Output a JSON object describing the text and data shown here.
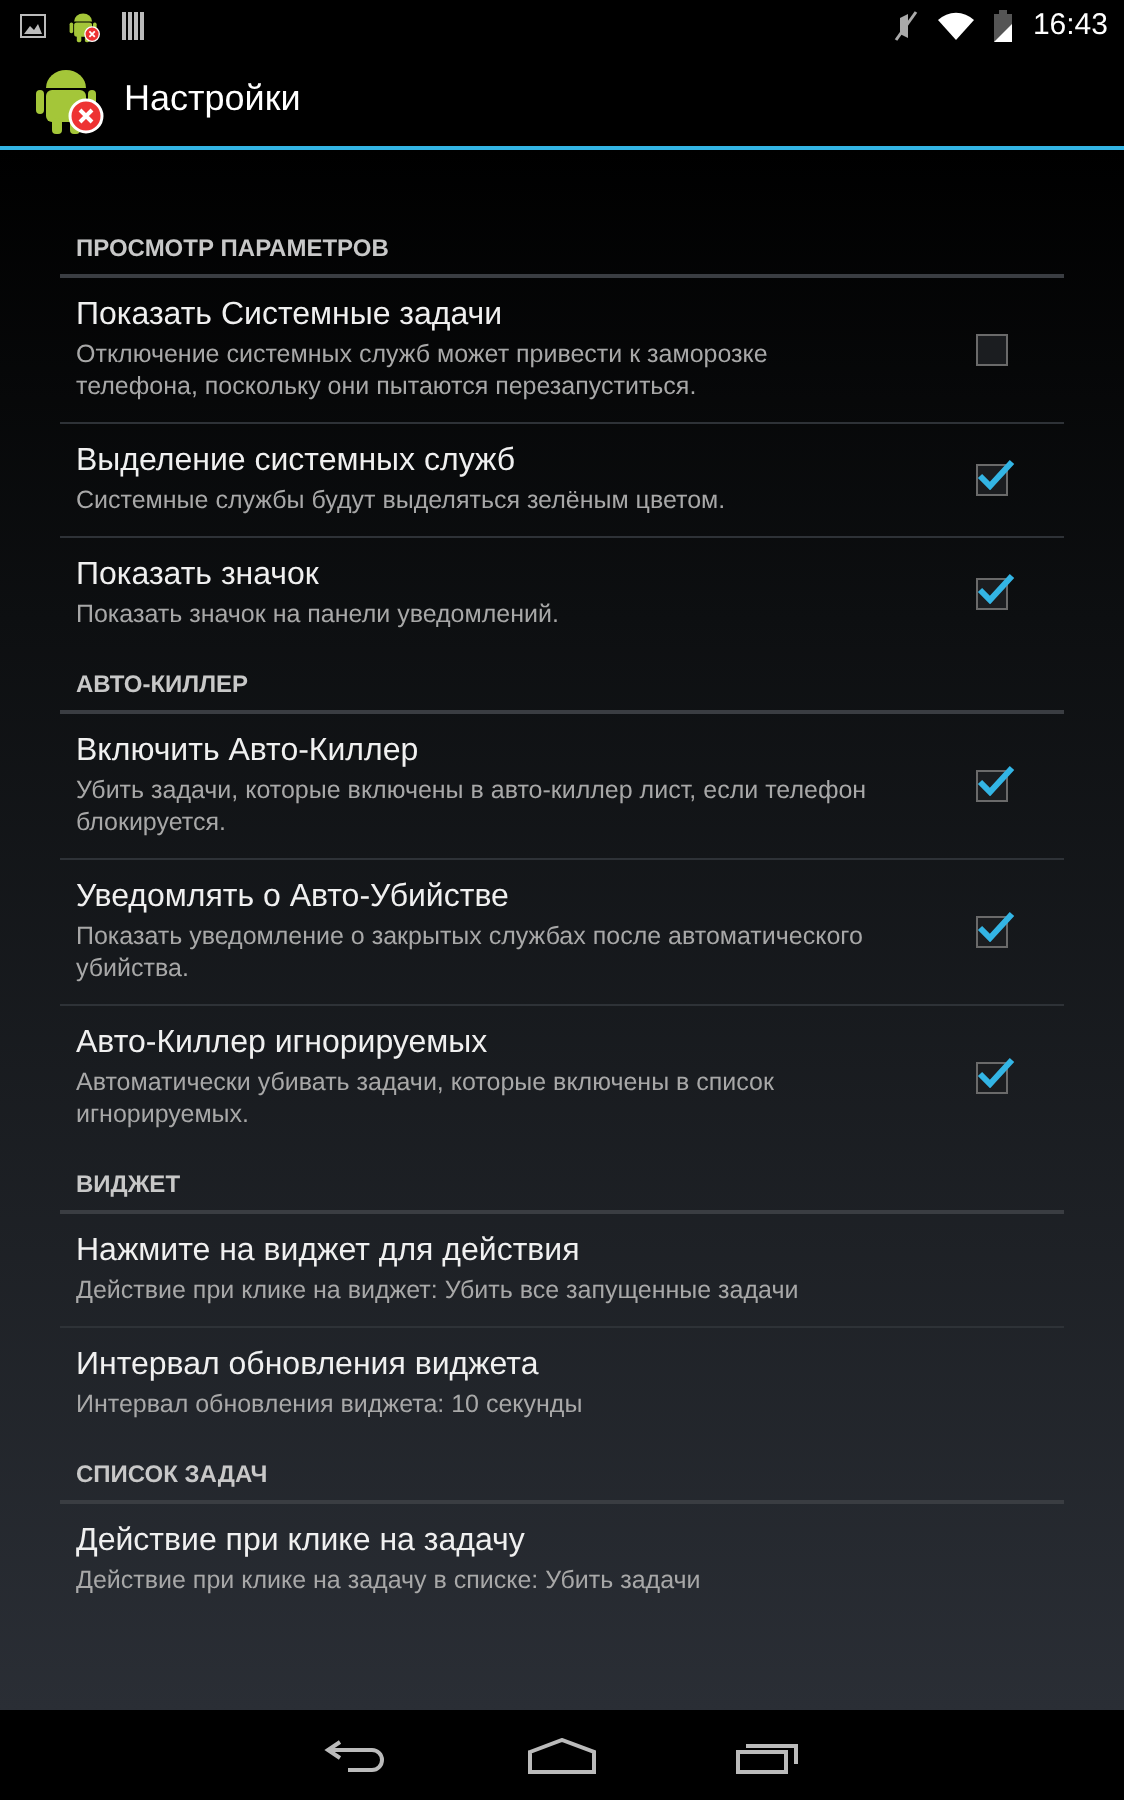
{
  "status_bar": {
    "time": "16:43"
  },
  "action_bar": {
    "title": "Настройки"
  },
  "sections": [
    {
      "header": "ПРОСМОТР ПАРАМЕТРОВ",
      "items": [
        {
          "kind": "checkbox",
          "title": "Показать Системные задачи",
          "summary": "Отключение системных служб может привести к заморозке телефона, поскольку они пытаются перезапуститься.",
          "checked": false
        },
        {
          "kind": "checkbox",
          "title": "Выделение системных служб",
          "summary": "Системные службы будут выделяться зелёным цветом.",
          "checked": true
        },
        {
          "kind": "checkbox",
          "title": "Показать значок",
          "summary": "Показать значок на панели уведомлений.",
          "checked": true
        }
      ]
    },
    {
      "header": "АВТО-КИЛЛЕР",
      "items": [
        {
          "kind": "checkbox",
          "title": "Включить Авто-Киллер",
          "summary": "Убить задачи, которые включены в авто-киллер лист, если телефон блокируется.",
          "checked": true
        },
        {
          "kind": "checkbox",
          "title": "Уведомлять о Авто-Убийстве",
          "summary": "Показать уведомление о закрытых службах после автоматического убийства.",
          "checked": true
        },
        {
          "kind": "checkbox",
          "title": "Авто-Киллер игнорируемых",
          "summary": "Автоматически убивать задачи, которые включены в список игнорируемых.",
          "checked": true
        }
      ]
    },
    {
      "header": "ВИДЖЕТ",
      "items": [
        {
          "kind": "plain",
          "title": "Нажмите на виджет для действия",
          "summary": "Действие при клике на виджет: Убить все запущенные задачи"
        },
        {
          "kind": "plain",
          "title": "Интервал обновления виджета",
          "summary": "Интервал обновления виджета: 10 секунды"
        }
      ]
    },
    {
      "header": "СПИСОК ЗАДАЧ",
      "items": [
        {
          "kind": "plain",
          "title": "Действие при клике на задачу",
          "summary": "Действие при клике на задачу в списке: Убить задачи"
        }
      ]
    }
  ]
}
